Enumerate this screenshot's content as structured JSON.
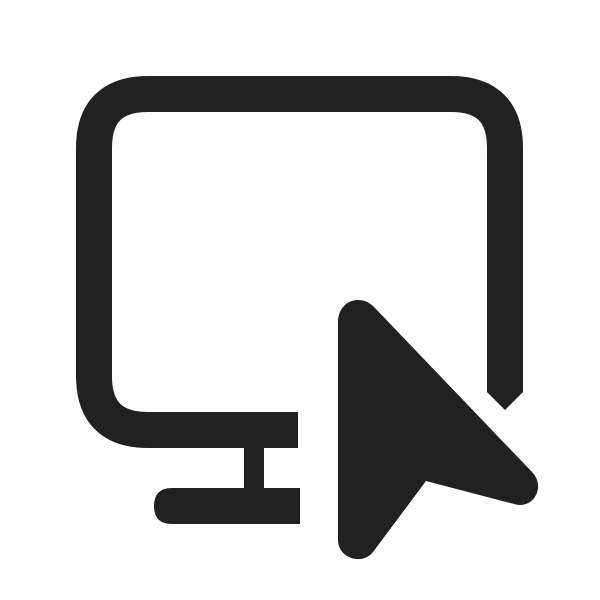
{
  "icon": {
    "name": "desktop-cursor-icon",
    "color": "#212121",
    "background": "#ffffff"
  }
}
